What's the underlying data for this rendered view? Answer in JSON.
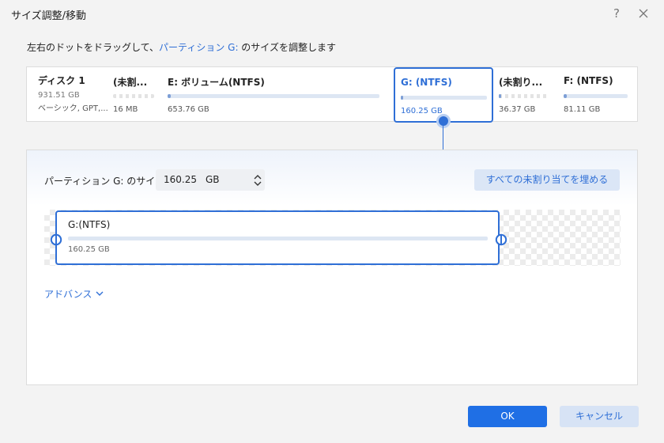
{
  "window": {
    "title": "サイズ調整/移動",
    "help_glyph": "?"
  },
  "instruction": {
    "prefix": "左右のドットをドラッグして、",
    "highlight": "パーティション G:",
    "suffix": " のサイズを調整します"
  },
  "disk": {
    "name": "ディスク 1",
    "size": "931.51 GB",
    "type": "ベーシック, GPT,...",
    "partitions": [
      {
        "label": "(未割...",
        "size": "16 MB",
        "kind": "unallocated",
        "used_fraction": 0
      },
      {
        "label": "E: ボリューム(NTFS)",
        "size": "653.76 GB",
        "kind": "ntfs",
        "used_fraction": 0.01
      },
      {
        "label": "G: (NTFS)",
        "size": "160.25 GB",
        "kind": "ntfs",
        "used_fraction": 0.01,
        "selected": true
      },
      {
        "label": "(未割り...",
        "size": "36.37 GB",
        "kind": "unallocated",
        "used_fraction": 0.03
      },
      {
        "label": "F: (NTFS)",
        "size": "81.11 GB",
        "kind": "ntfs",
        "used_fraction": 0.03
      }
    ]
  },
  "resize": {
    "size_label": "パーティション G: のサイズ",
    "size_value": "160.25",
    "size_unit": "GB",
    "fill_button": "すべての未割り当てを埋める",
    "partition_label": "G:(NTFS)",
    "partition_size": "160.25 GB",
    "advance_label": "アドバンス"
  },
  "footer": {
    "ok": "OK",
    "cancel": "キャンセル"
  },
  "colors": {
    "accent": "#2f6fd6",
    "ok_bg": "#1f6fe5",
    "secondary_bg": "#dbe6f6"
  }
}
